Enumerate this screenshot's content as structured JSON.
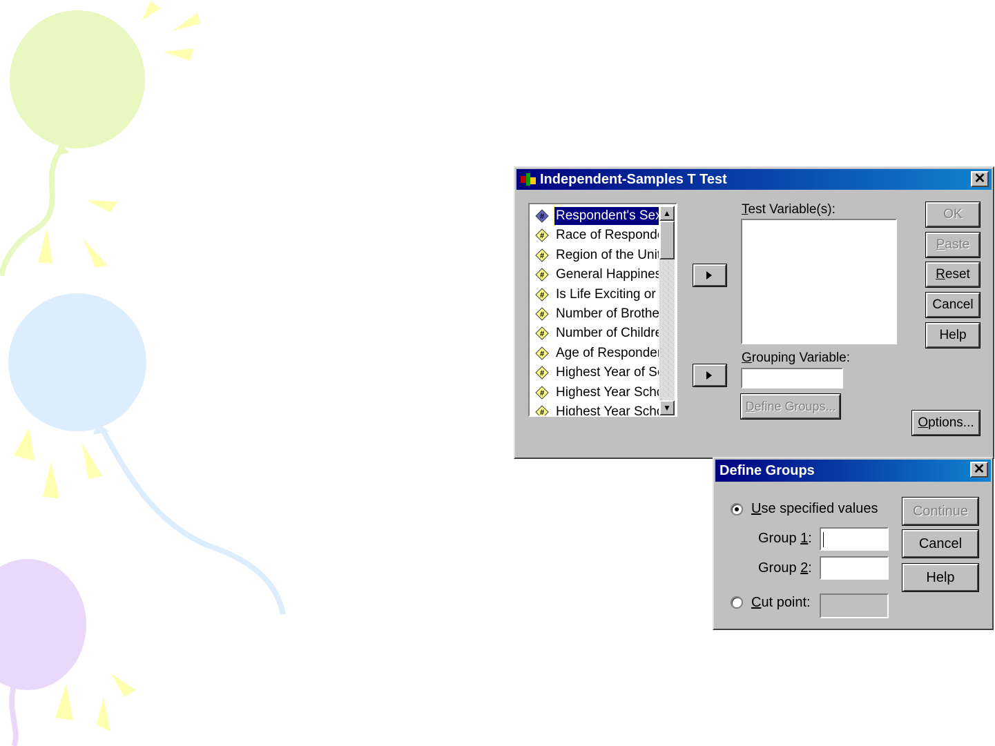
{
  "main_dialog": {
    "title": "Independent-Samples T Test",
    "close_glyph": "✕",
    "variables": [
      {
        "label": "Respondent's Sex",
        "selected": true
      },
      {
        "label": "Race of Responde",
        "selected": false
      },
      {
        "label": "Region of the Unite",
        "selected": false
      },
      {
        "label": "General Happiness",
        "selected": false
      },
      {
        "label": "Is Life Exciting or D",
        "selected": false
      },
      {
        "label": "Number of Brothers",
        "selected": false
      },
      {
        "label": "Number of Children",
        "selected": false
      },
      {
        "label": "Age of Respondent",
        "selected": false
      },
      {
        "label": "Highest Year of Scl",
        "selected": false
      },
      {
        "label": "Highest Year Schoo",
        "selected": false
      },
      {
        "label": "Highest Year Schoo",
        "selected": false
      }
    ],
    "variable_icon": "numeric-variable-icon",
    "test_variables_label": {
      "accel": "T",
      "rest": "est Variable(s):"
    },
    "grouping_variable_label": {
      "accel": "G",
      "rest": "rouping Variable:"
    },
    "grouping_variable_value": "",
    "define_groups_button": {
      "accel": "D",
      "rest": "efine Groups..."
    },
    "buttons": {
      "ok": "OK",
      "paste": {
        "accel": "P",
        "rest": "aste"
      },
      "reset": {
        "accel": "R",
        "rest": "eset"
      },
      "cancel": "Cancel",
      "help": "Help",
      "options": {
        "accel": "O",
        "rest": "ptions..."
      }
    }
  },
  "define_groups_dialog": {
    "title": "Define Groups",
    "close_glyph": "✕",
    "use_specified": {
      "accel": "U",
      "rest": "se specified values",
      "checked": true
    },
    "group1": {
      "pre": "Group ",
      "accel": "1",
      "post": ":",
      "value": ""
    },
    "group2": {
      "pre": "Group ",
      "accel": "2",
      "post": ":",
      "value": ""
    },
    "cut_point": {
      "accel": "C",
      "rest": "ut point:",
      "checked": false,
      "value": ""
    },
    "buttons": {
      "continue": "Continue",
      "cancel": "Cancel",
      "help": "Help"
    }
  },
  "colors": {
    "title_start": "#000080",
    "title_end": "#1084d0",
    "dialog_face": "#c0c0c0",
    "balloon_green": "#e8f8c0",
    "balloon_blue": "#dceefe",
    "balloon_purple": "#ead8fa",
    "ray_yellow": "#ffffb0"
  }
}
